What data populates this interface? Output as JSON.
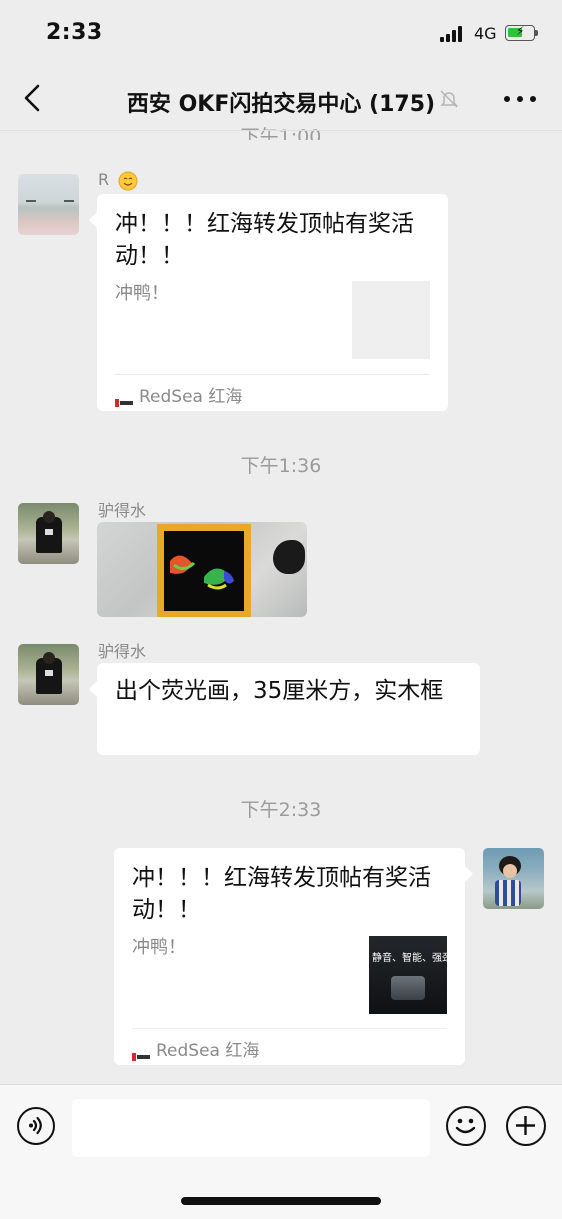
{
  "status": {
    "time": "2:33",
    "network": "4G"
  },
  "header": {
    "title": "西安 OKF闪拍交易中心 (175)"
  },
  "messages": {
    "ts_partial": "下午1:00",
    "msg1": {
      "sender": "R",
      "card": {
        "title": "冲！！！红海转发顶帖有奖活动！！",
        "desc": "冲鸭！",
        "source": "RedSea 红海"
      }
    },
    "ts1": "下午1:36",
    "msg2": {
      "sender": "驴得水"
    },
    "msg3": {
      "sender": "驴得水",
      "text": "出个荧光画，35厘米方，实木框"
    },
    "ts2": "下午2:33",
    "msg4": {
      "card": {
        "title": "冲！！！红海转发顶帖有奖活动！！",
        "desc": "冲鸭！",
        "thumb_text": "静音、智能、强劲",
        "source": "RedSea 红海"
      }
    }
  },
  "icons": {
    "back": "chevron-left-icon",
    "mute": "bell-slash-icon",
    "more": "more-icon",
    "voice": "voice-icon",
    "emoji": "emoji-icon",
    "plus": "plus-icon"
  },
  "colors": {
    "background": "#ededed",
    "bubble": "#ffffff",
    "battery": "#2fc33b"
  }
}
